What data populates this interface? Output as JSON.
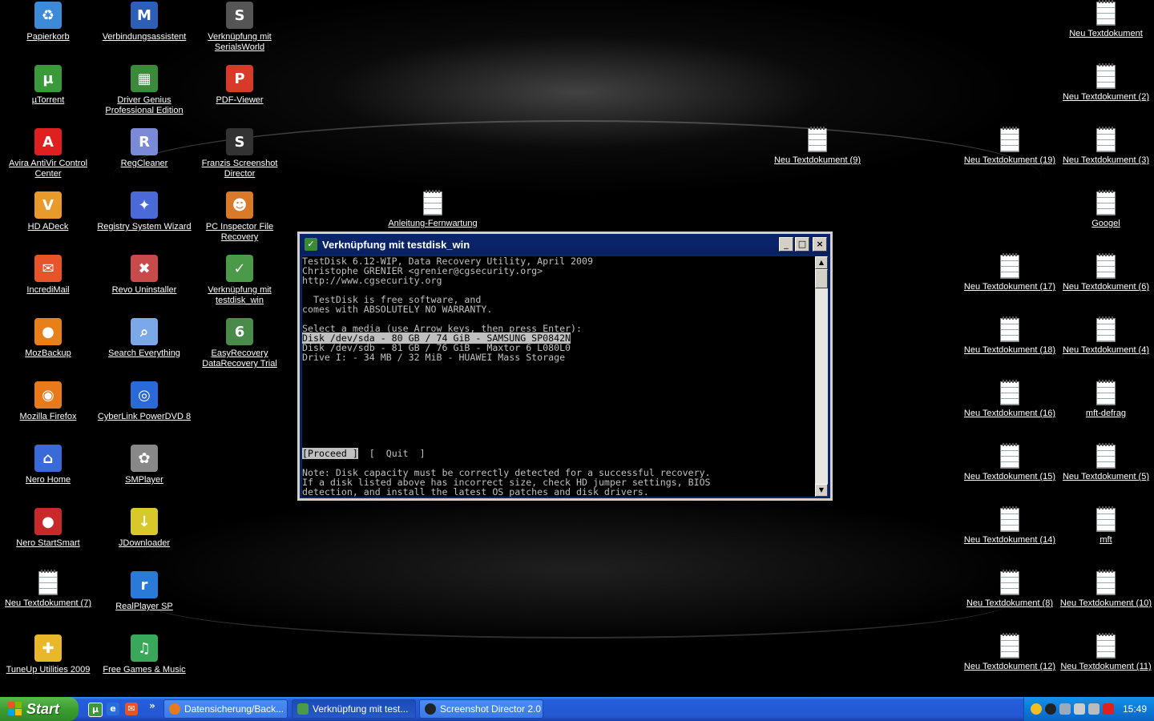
{
  "desktop": {
    "icons_left": [
      {
        "label": "Papierkorb",
        "icon": "recycle-bin-icon"
      },
      {
        "label": "Verbindungsassistent",
        "icon": "connection-wizard-icon"
      },
      {
        "label": "Verknüpfung mit SerialsWorld",
        "icon": "serialsworld-icon"
      },
      {
        "label": "µTorrent",
        "icon": "utorrent-icon"
      },
      {
        "label": "Driver Genius Professional Edition",
        "icon": "driver-genius-icon"
      },
      {
        "label": "PDF-Viewer",
        "icon": "pdf-viewer-icon"
      },
      {
        "label": "Avira AntiVir Control Center",
        "icon": "avira-icon"
      },
      {
        "label": "RegCleaner",
        "icon": "regcleaner-icon"
      },
      {
        "label": "Franzis Screenshot Director",
        "icon": "screenshot-director-icon"
      },
      {
        "label": "HD ADeck",
        "icon": "hd-adeck-icon"
      },
      {
        "label": "Registry System Wizard",
        "icon": "registry-wizard-icon"
      },
      {
        "label": "PC Inspector File Recovery",
        "icon": "pc-inspector-icon"
      },
      {
        "label": "IncrediMail",
        "icon": "incredimail-icon"
      },
      {
        "label": "Revo Uninstaller",
        "icon": "revo-uninstaller-icon"
      },
      {
        "label": "Verknüpfung mit testdisk_win",
        "icon": "testdisk-icon"
      },
      {
        "label": "MozBackup",
        "icon": "mozbackup-icon"
      },
      {
        "label": "Search Everything",
        "icon": "search-everything-icon"
      },
      {
        "label": "EasyRecovery DataRecovery Trial",
        "icon": "easyrecovery-icon"
      },
      {
        "label": "Mozilla Firefox",
        "icon": "firefox-icon"
      },
      {
        "label": "CyberLink PowerDVD 8",
        "icon": "powerdvd-icon"
      },
      {
        "label": "Nero Home",
        "icon": "nero-home-icon"
      },
      {
        "label": "SMPlayer",
        "icon": "smplayer-icon"
      },
      {
        "label": "Nero StartSmart",
        "icon": "nero-startsmart-icon"
      },
      {
        "label": "JDownloader",
        "icon": "jdownloader-icon"
      },
      {
        "label": "Neu Textdokument (7)",
        "icon": "text-document-icon"
      },
      {
        "label": "RealPlayer SP",
        "icon": "realplayer-icon"
      },
      {
        "label": "TuneUp Utilities 2009",
        "icon": "tuneup-icon"
      },
      {
        "label": "Free Games & Music",
        "icon": "free-games-icon"
      }
    ],
    "icons_middle": [
      {
        "label": "Anleitung-Fernwartung",
        "icon": "text-document-icon"
      },
      {
        "label": "Neu Textdokument (9)",
        "icon": "text-document-icon"
      }
    ],
    "icons_right": [
      {
        "label": "Neu Textdokument",
        "icon": "text-document-icon"
      },
      {
        "label": "Neu Textdokument (2)",
        "icon": "text-document-icon"
      },
      {
        "label": "Neu Textdokument (19)",
        "icon": "text-document-icon"
      },
      {
        "label": "Neu Textdokument (3)",
        "icon": "text-document-icon"
      },
      {
        "label": "Googel",
        "icon": "text-document-icon"
      },
      {
        "label": "Neu Textdokument (17)",
        "icon": "text-document-icon"
      },
      {
        "label": "Neu Textdokument (6)",
        "icon": "text-document-icon"
      },
      {
        "label": "Neu Textdokument (18)",
        "icon": "text-document-icon"
      },
      {
        "label": "Neu Textdokument (4)",
        "icon": "text-document-icon"
      },
      {
        "label": "Neu Textdokument (16)",
        "icon": "text-document-icon"
      },
      {
        "label": "mft-defrag",
        "icon": "text-document-icon"
      },
      {
        "label": "Neu Textdokument (15)",
        "icon": "text-document-icon"
      },
      {
        "label": "Neu Textdokument (5)",
        "icon": "text-document-icon"
      },
      {
        "label": "Neu Textdokument (14)",
        "icon": "text-document-icon"
      },
      {
        "label": "mft",
        "icon": "text-document-icon"
      },
      {
        "label": "Neu Textdokument (8)",
        "icon": "text-document-icon"
      },
      {
        "label": "Neu Textdokument (10)",
        "icon": "text-document-icon"
      },
      {
        "label": "Neu Textdokument (12)",
        "icon": "text-document-icon"
      },
      {
        "label": "Neu Textdokument (11)",
        "icon": "text-document-icon"
      }
    ]
  },
  "console_window": {
    "title": "Verknüpfung mit testdisk_win",
    "minimize": "_",
    "maximize": "□",
    "close": "×",
    "header_lines": [
      "TestDisk 6.12-WIP, Data Recovery Utility, April 2009",
      "Christophe GRENIER <grenier@cgsecurity.org>",
      "http://www.cgsecurity.org",
      "",
      "  TestDisk is free software, and",
      "comes with ABSOLUTELY NO WARRANTY.",
      "",
      "Select a media (use Arrow keys, then press Enter):"
    ],
    "media": [
      {
        "text": "Disk /dev/sda - 80 GB / 74 GiB - SAMSUNG SP0842N",
        "selected": true
      },
      {
        "text": "Disk /dev/sdb - 81 GB / 76 GiB - Maxtor 6 L080L0",
        "selected": false
      },
      {
        "text": "Drive I: - 34 MB / 32 MiB - HUAWEI Mass Storage",
        "selected": false
      }
    ],
    "proceed": "[Proceed ]",
    "quit": "[  Quit  ]",
    "note_lines": [
      "Note: Disk capacity must be correctly detected for a successful recovery.",
      "If a disk listed above has incorrect size, check HD jumper settings, BIOS",
      "detection, and install the latest OS patches and disk drivers."
    ]
  },
  "taskbar": {
    "start_label": "Start",
    "overflow": "»",
    "tasks": [
      {
        "label": "Datensicherung/Back...",
        "icon": "firefox-icon",
        "active": false
      },
      {
        "label": "Verknüpfung mit test...",
        "icon": "testdisk-icon",
        "active": true
      },
      {
        "label": "Screenshot Director 2.0",
        "icon": "screenshot-director-icon",
        "active": false
      }
    ],
    "clock": "15:49"
  }
}
